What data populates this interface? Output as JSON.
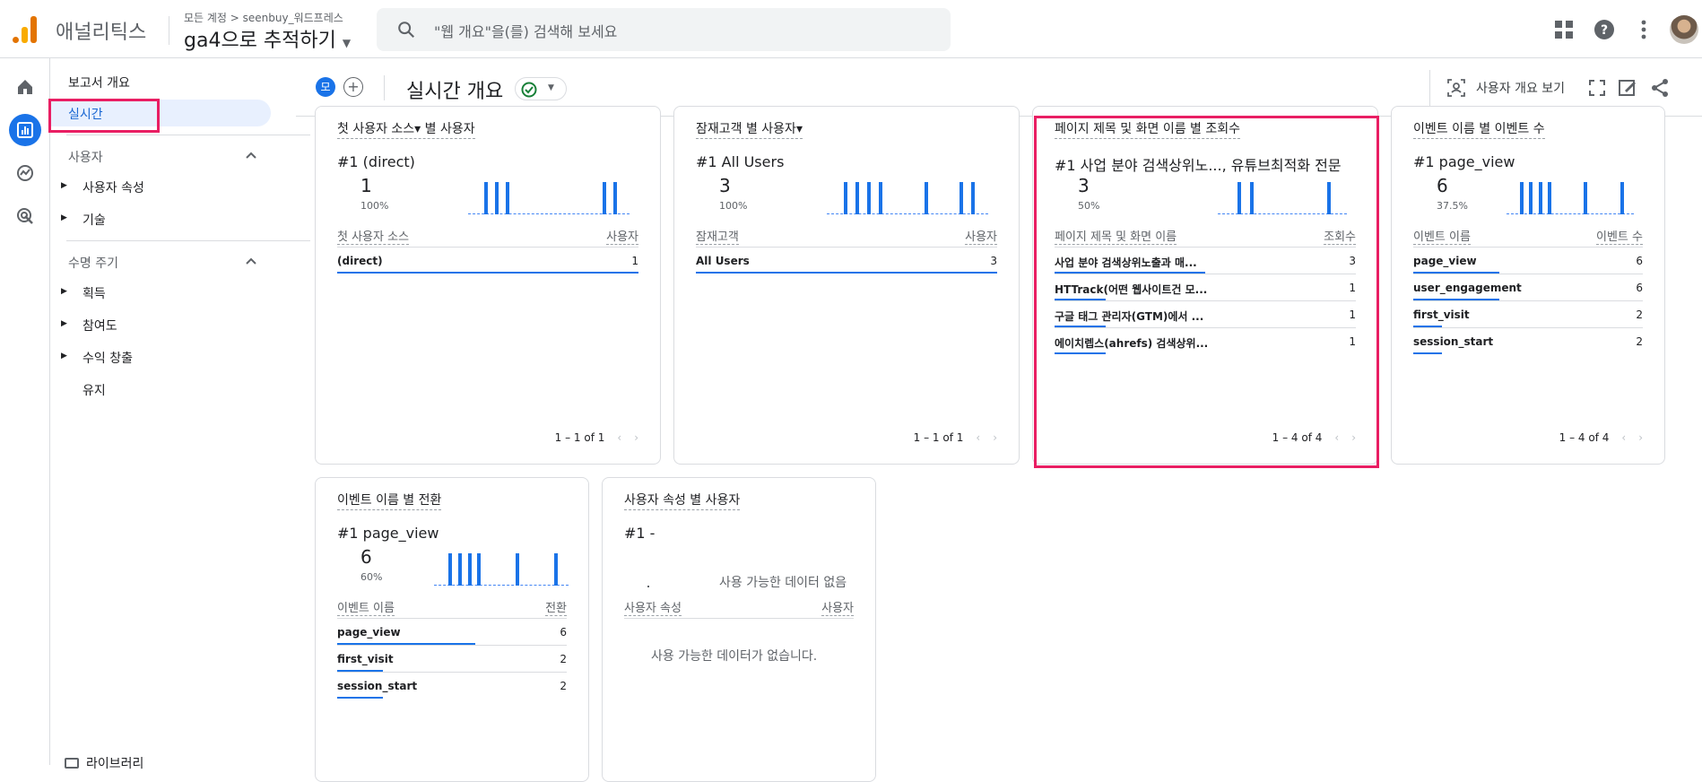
{
  "app": {
    "brand": "애널리틱스",
    "breadcrumb": "모든 계정 > seenbuy_워드프레스",
    "property": "ga4으로 추적하기",
    "search_placeholder": "\"웹 개요\"을(를) 검색해 보세요",
    "icons": [
      "search-icon",
      "apps-grid-icon",
      "help-icon",
      "more-vert-icon",
      "avatar"
    ]
  },
  "sidebar": {
    "report_overview": "보고서 개요",
    "realtime": "실시간",
    "user_section": "사용자",
    "user_items": [
      "사용자 속성",
      "기술"
    ],
    "lifecycle_section": "수명 주기",
    "lifecycle_items": [
      "획득",
      "참여도",
      "수익 창출",
      "유지"
    ],
    "library": "라이브러리"
  },
  "header": {
    "comparison_chip": "모",
    "title": "실시간 개요",
    "user_overview_button": "사용자 개요 보기",
    "icons": [
      "add-comparison-icon",
      "status-check-icon",
      "user-overview-icon",
      "fullscreen-icon",
      "customize-icon",
      "share-icon"
    ]
  },
  "cards": [
    {
      "title": "첫 사용자 소스▾ 별 사용자",
      "top": "#1  (direct)",
      "value": "1",
      "pct": "100%",
      "col_left": "첫 사용자 소스",
      "col_right": "사용자",
      "rows": [
        {
          "name": "(direct)",
          "value": "1",
          "share": 1.0
        }
      ],
      "pager": "1 – 1 of 1",
      "spark": [
        1,
        1,
        1,
        0,
        0,
        0,
        0,
        0,
        0,
        0,
        0,
        1,
        1
      ]
    },
    {
      "title": "잠재고객 별 사용자▾",
      "top": "#1  All Users",
      "value": "3",
      "pct": "100%",
      "col_left": "잠재고객",
      "col_right": "사용자",
      "rows": [
        {
          "name": "All Users",
          "value": "3",
          "share": 1.0
        }
      ],
      "pager": "1 – 1 of 1",
      "spark": [
        1,
        1,
        1,
        1,
        0,
        0,
        0,
        1,
        0,
        0,
        1,
        1
      ]
    },
    {
      "title": "페이지 제목 및 화면 이름 별 조회수",
      "top": "#1  사업 분야 검색상위노..., 유튜브최적화 전문",
      "value": "3",
      "pct": "50%",
      "col_left": "페이지 제목 및 화면 이름",
      "col_right": "조회수",
      "rows": [
        {
          "name": "사업 분야 검색상위노출과 매...",
          "value": "3",
          "share": 0.5
        },
        {
          "name": "HTTrack(어떤 웹사이트건 모...",
          "value": "1",
          "share": 0.17
        },
        {
          "name": "구글 태그 관리자(GTM)에서 ...",
          "value": "1",
          "share": 0.17
        },
        {
          "name": "에이치렙스(ahrefs) 검색상위...",
          "value": "1",
          "share": 0.17
        }
      ],
      "pager": "1 – 4 of 4",
      "spark": [
        1,
        1,
        0,
        0,
        0,
        0,
        0,
        1
      ]
    },
    {
      "title": "이벤트 이름 별 이벤트 수",
      "top": "#1  page_view",
      "value": "6",
      "pct": "37.5%",
      "col_left": "이벤트 이름",
      "col_right": "이벤트 수",
      "rows": [
        {
          "name": "page_view",
          "value": "6",
          "share": 0.375
        },
        {
          "name": "user_engagement",
          "value": "6",
          "share": 0.375
        },
        {
          "name": "first_visit",
          "value": "2",
          "share": 0.125
        },
        {
          "name": "session_start",
          "value": "2",
          "share": 0.125
        }
      ],
      "pager": "1 – 4 of 4",
      "spark": [
        1,
        1,
        1,
        1,
        0,
        0,
        0,
        1,
        0,
        0,
        0,
        1
      ]
    },
    {
      "title": "이벤트 이름 별 전환",
      "top": "#1  page_view",
      "value": "6",
      "pct": "60%",
      "col_left": "이벤트 이름",
      "col_right": "전환",
      "rows": [
        {
          "name": "page_view",
          "value": "6",
          "share": 0.6
        },
        {
          "name": "first_visit",
          "value": "2",
          "share": 0.2
        },
        {
          "name": "session_start",
          "value": "2",
          "share": 0.2
        }
      ],
      "spark": [
        1,
        1,
        1,
        1,
        0,
        0,
        0,
        1,
        0,
        0,
        0,
        1
      ]
    },
    {
      "title": "사용자 속성 별 사용자",
      "top": "#1  -",
      "nodata_chart": "사용 가능한 데이터 없음",
      "col_left": "사용자 속성",
      "col_right": "사용자",
      "nodata_table": "사용 가능한 데이터가 없습니다."
    }
  ]
}
